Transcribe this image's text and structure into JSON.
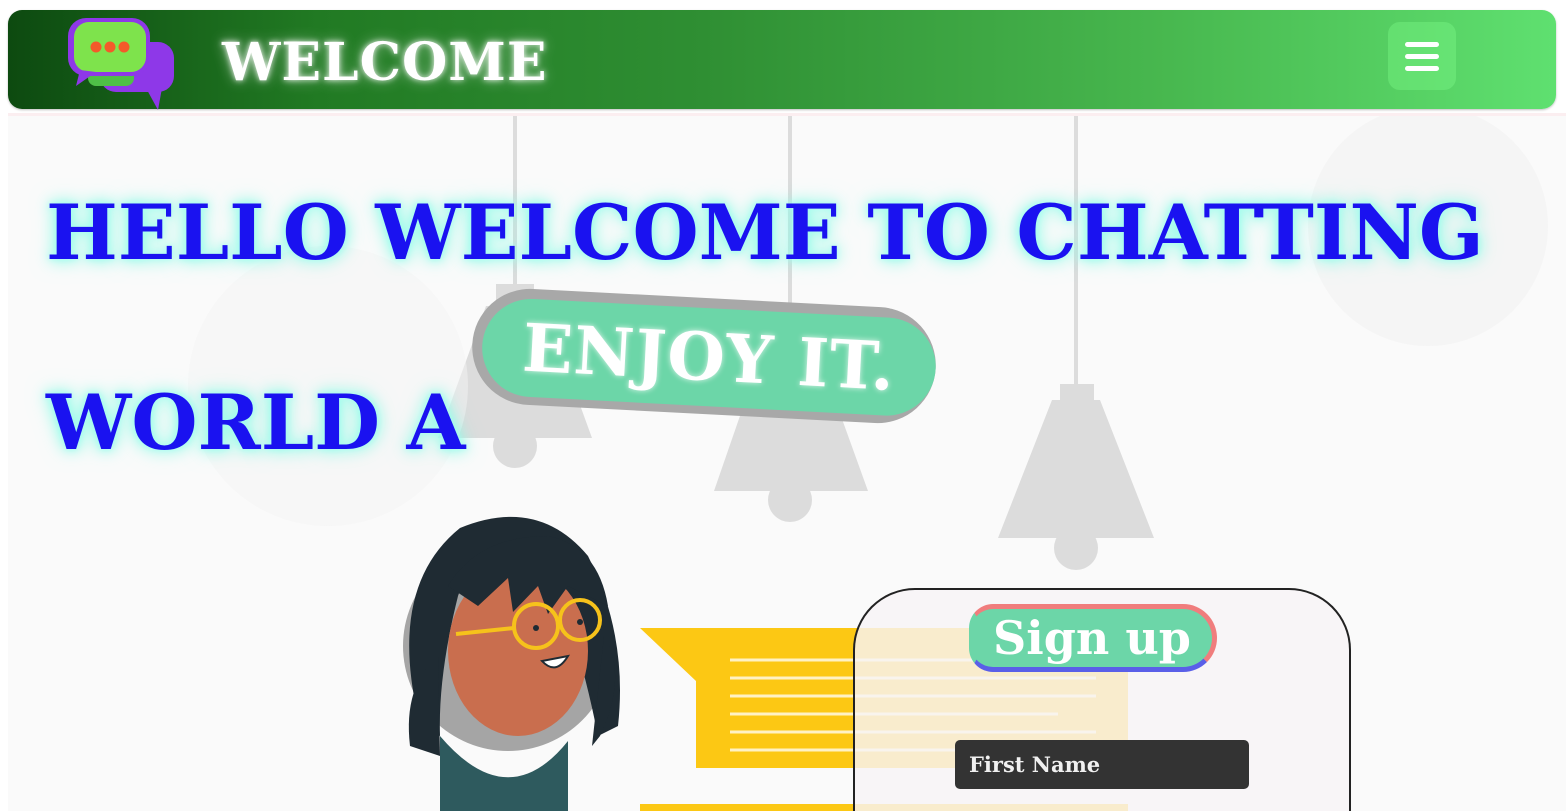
{
  "navbar": {
    "brand": "WELCOME",
    "logo_icon": "chat-bubbles-icon",
    "menu_icon": "hamburger-menu-icon",
    "gradient_start": "#0d4a10",
    "gradient_end": "#5fe070"
  },
  "hero": {
    "headline_line1": "HELLO WELCOME TO CHATTING",
    "headline_line2": "WORLD A",
    "badge": "ENJOY IT.",
    "headline_color": "#1a12f0",
    "badge_color": "#6cd6a8"
  },
  "signup": {
    "title": "Sign up",
    "fields": [
      {
        "placeholder": "First Name",
        "value": ""
      }
    ]
  }
}
